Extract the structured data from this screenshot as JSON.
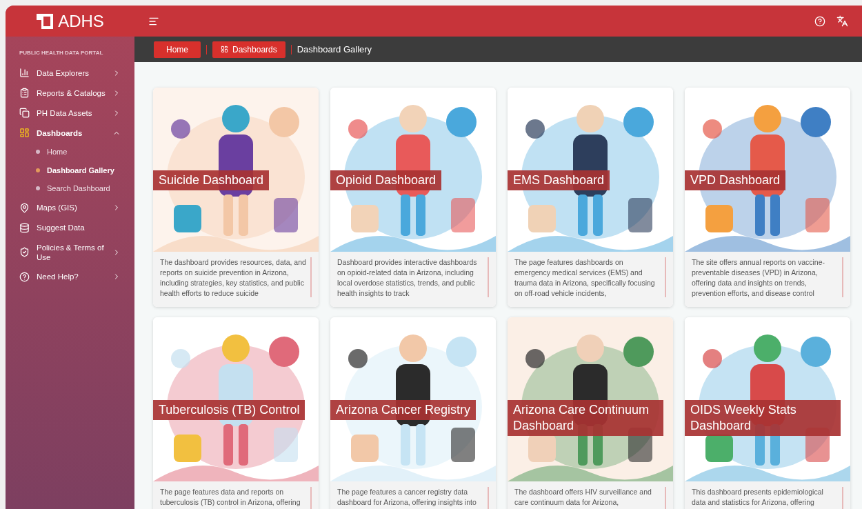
{
  "header": {
    "logo_text": "ADHS"
  },
  "sidebar": {
    "title": "PUBLIC HEALTH DATA PORTAL",
    "items": [
      {
        "label": "Data Explorers",
        "expandable": true,
        "expanded": false,
        "selected": false
      },
      {
        "label": "Reports & Catalogs",
        "expandable": true,
        "expanded": false,
        "selected": false
      },
      {
        "label": "PH Data Assets",
        "expandable": true,
        "expanded": false,
        "selected": false
      },
      {
        "label": "Dashboards",
        "expandable": true,
        "expanded": true,
        "selected": true,
        "children": [
          {
            "label": "Home",
            "selected": false
          },
          {
            "label": "Dashboard Gallery",
            "selected": true
          },
          {
            "label": "Search Dashboard",
            "selected": false
          }
        ]
      },
      {
        "label": "Maps (GIS)",
        "expandable": true,
        "expanded": false,
        "selected": false
      },
      {
        "label": "Suggest Data",
        "expandable": false,
        "expanded": false,
        "selected": false
      },
      {
        "label": "Policies & Terms of Use",
        "expandable": true,
        "expanded": false,
        "selected": false
      },
      {
        "label": "Need Help?",
        "expandable": true,
        "expanded": false,
        "selected": false
      }
    ]
  },
  "breadcrumb": [
    {
      "label": "Home",
      "kind": "link"
    },
    {
      "label": "Dashboards",
      "kind": "icon-link"
    },
    {
      "label": "Dashboard Gallery",
      "kind": "current"
    }
  ],
  "cards": [
    {
      "title": "Suicide Dashboard",
      "description": "The dashboard provides resources, data, and reports on suicide prevention in Arizona, including strategies, key statistics, and public health efforts to reduce suicide"
    },
    {
      "title": "Opioid Dashboard",
      "description": "Dashboard provides interactive dashboards on opioid-related data in Arizona, including local overdose statistics, trends, and public health insights to track"
    },
    {
      "title": "EMS Dashboard",
      "description": "The page features dashboards on emergency medical services (EMS) and trauma data in Arizona, specifically focusing on off-road vehicle incidents,"
    },
    {
      "title": "VPD Dashboard",
      "description": "The site offers annual reports on vaccine-preventable diseases (VPD) in Arizona, offering data and insights on trends, prevention efforts, and disease control"
    },
    {
      "title": "Tuberculosis (TB) Control",
      "description": "The page features data and reports on tuberculosis (TB) control in Arizona, offering"
    },
    {
      "title": "Arizona Cancer Registry",
      "description": "The page features a cancer registry data dashboard for Arizona, offering insights into"
    },
    {
      "title": "Arizona Care Continuum Dashboard",
      "description": "The dashboard offers HIV surveillance and care continuum data for Arizona,"
    },
    {
      "title": "OIDS Weekly Stats Dashboard",
      "description": "This dashboard presents epidemiological data and statistics for Arizona, offering"
    }
  ]
}
